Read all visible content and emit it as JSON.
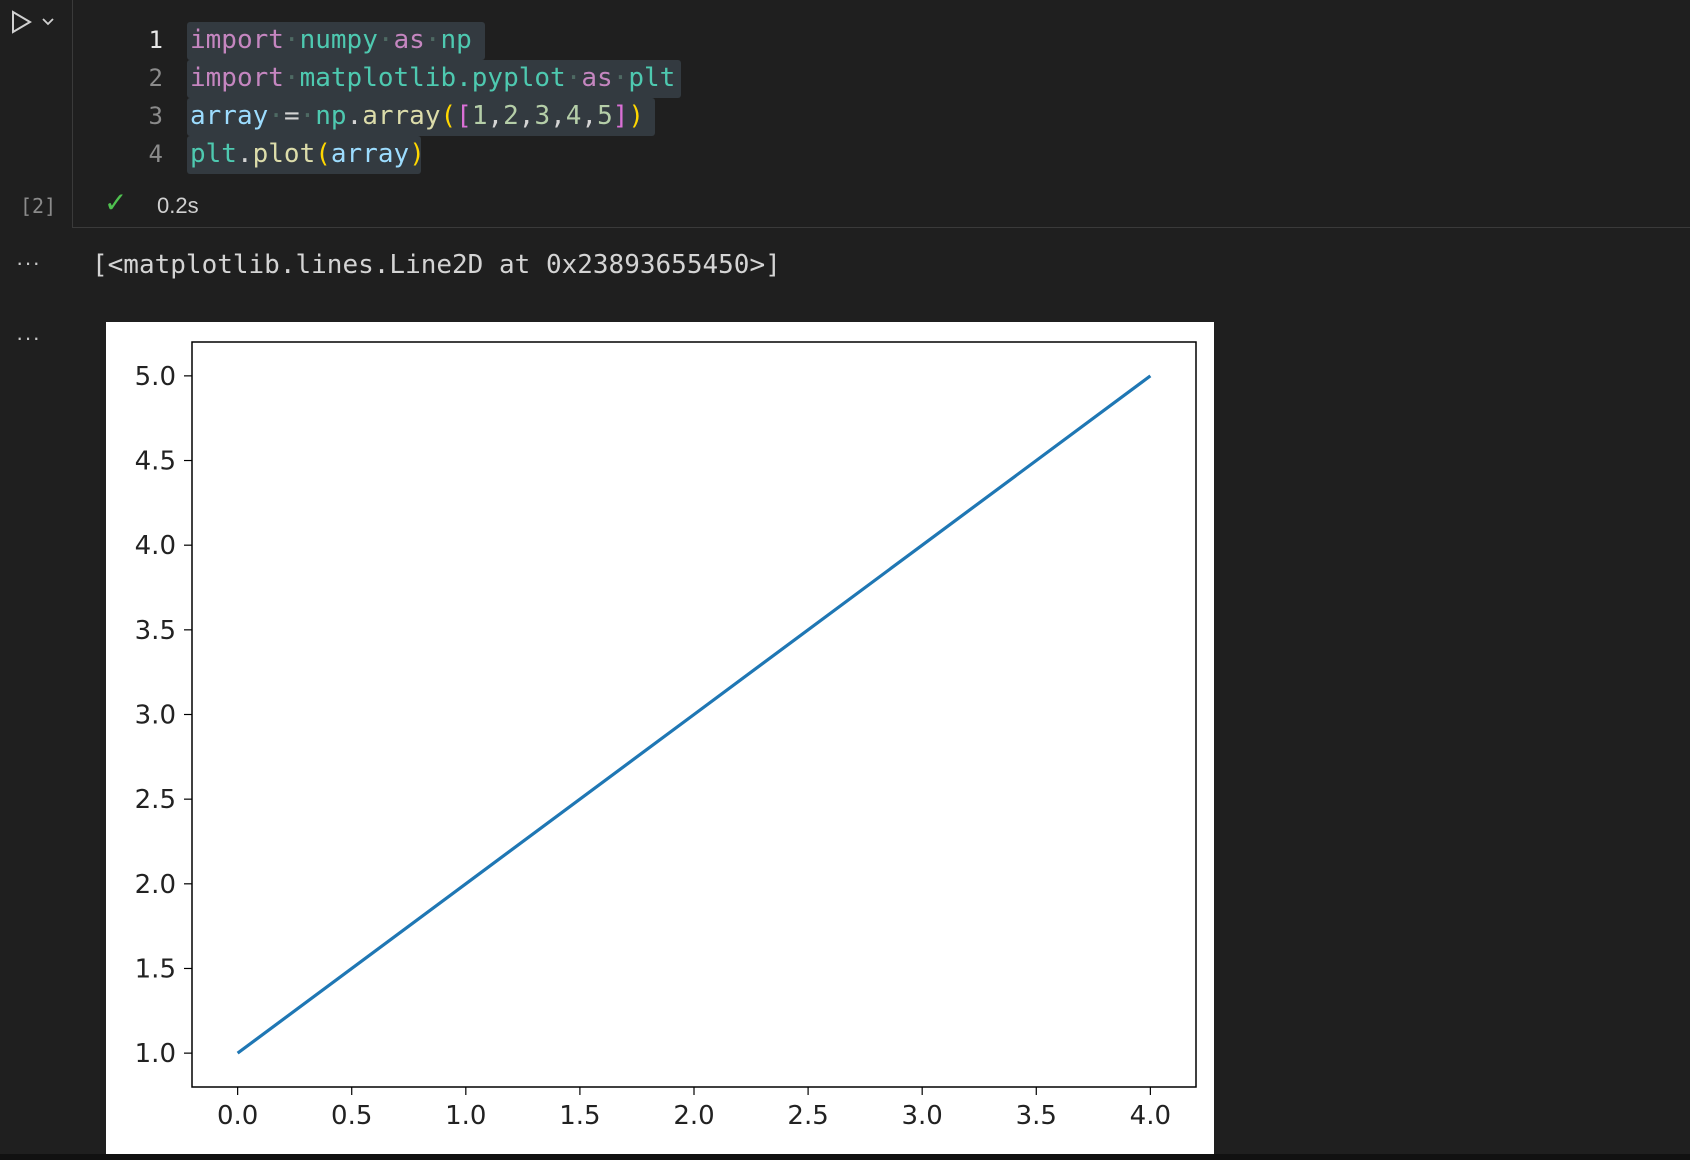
{
  "cell": {
    "execution_count": "[2]",
    "exec_time": "0.2s",
    "status_icon": "check-icon",
    "run_icon": "play-icon",
    "run_menu_icon": "chevron-down-icon"
  },
  "code": {
    "line_numbers": [
      "1",
      "2",
      "3",
      "4"
    ],
    "lines": [
      "import numpy as np",
      "import matplotlib.pyplot as plt",
      "array = np.array([1,2,3,4,5])",
      "plt.plot(array)"
    ],
    "tokens": {
      "l1": {
        "import": "import",
        "numpy": "numpy",
        "as": "as",
        "np": "np"
      },
      "l2": {
        "import": "import",
        "module": "matplotlib.pyplot",
        "as": "as",
        "plt": "plt"
      },
      "l3": {
        "array": "array",
        "eq": "=",
        "np": "np",
        "dot": ".",
        "fn": "array",
        "open": "(",
        "lb": "[",
        "n1": "1",
        "c1": ",",
        "n2": "2",
        "c2": ",",
        "n3": "3",
        "c3": ",",
        "n4": "4",
        "c4": ",",
        "n5": "5",
        "rb": "]",
        "close": ")"
      },
      "l4": {
        "plt": "plt",
        "dot": ".",
        "fn": "plot",
        "open": "(",
        "arg": "array",
        "close": ")"
      }
    }
  },
  "output": {
    "more_label": "···",
    "text": "[<matplotlib.lines.Line2D at 0x23893655450>]"
  },
  "colors": {
    "background": "#1f1f1f",
    "keyword": "#c586c0",
    "module": "#4ec9b0",
    "variable": "#9cdcfe",
    "function": "#dcdcaa",
    "number": "#b5cea8",
    "line_color": "#1f77b4",
    "success": "#4fc14f"
  },
  "chart_data": {
    "type": "line",
    "x": [
      0,
      1,
      2,
      3,
      4
    ],
    "series": [
      {
        "values": [
          1,
          2,
          3,
          4,
          5
        ]
      }
    ],
    "x_ticks": [
      "0.0",
      "0.5",
      "1.0",
      "1.5",
      "2.0",
      "2.5",
      "3.0",
      "3.5",
      "4.0"
    ],
    "y_ticks": [
      "1.0",
      "1.5",
      "2.0",
      "2.5",
      "3.0",
      "3.5",
      "4.0",
      "4.5",
      "5.0"
    ],
    "xlim": [
      -0.2,
      4.2
    ],
    "ylim": [
      0.8,
      5.2
    ],
    "grid": false,
    "title": "",
    "xlabel": "",
    "ylabel": ""
  }
}
